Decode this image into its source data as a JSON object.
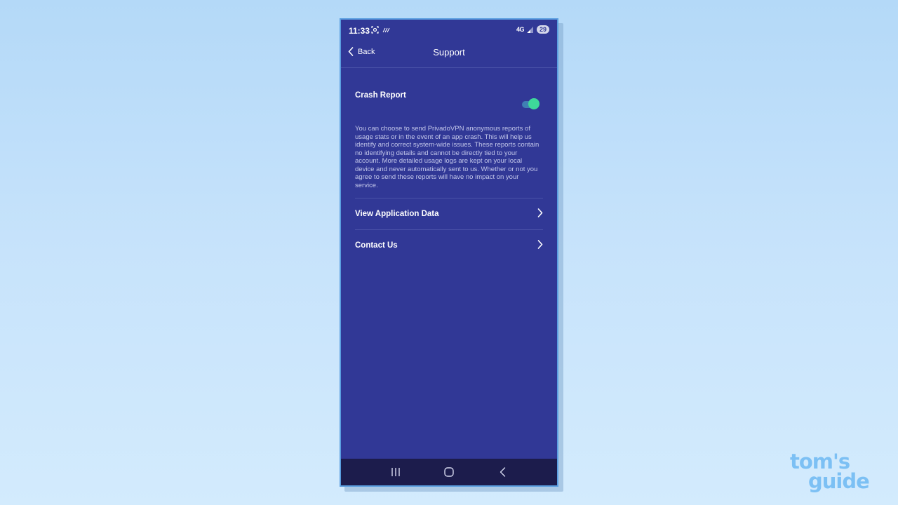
{
  "status_bar": {
    "time": "11:33",
    "network": "4G",
    "battery": "29"
  },
  "header": {
    "back_label": "Back",
    "title": "Support"
  },
  "crash_report": {
    "title": "Crash Report",
    "enabled": true,
    "description": "You can choose to send PrivadoVPN anonymous reports of usage stats or in the event of an app crash. This will help us identify and correct system-wide issues. These reports contain no identifying details and cannot be directly tied to your account. More detailed usage logs are kept on your local device and never automatically sent to us. Whether or not you agree to send these reports will have no impact on your service."
  },
  "menu": [
    {
      "label": "View Application Data",
      "icon": "chevron-right-icon"
    },
    {
      "label": "Contact Us",
      "icon": "chevron-right-icon"
    }
  ],
  "watermark": {
    "line1": "tom's",
    "line2": "guide"
  },
  "colors": {
    "app_background": "#313896",
    "nav_bar": "#1c1c4c",
    "toggle_on": "#3ed89a",
    "watermark": "#7cc0f4"
  }
}
